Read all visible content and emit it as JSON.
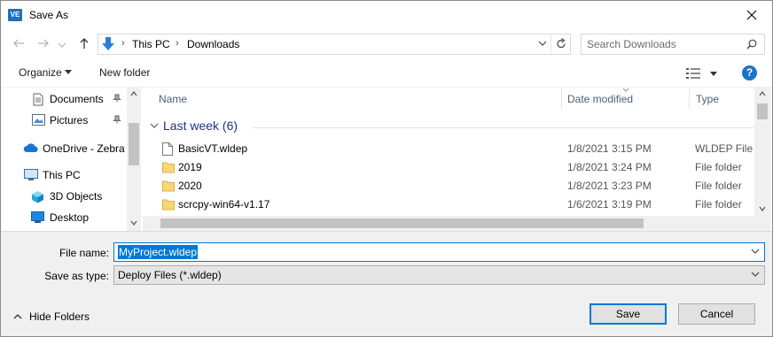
{
  "window": {
    "title": "Save As",
    "app_icon_text": "VE"
  },
  "address": {
    "crumbs": [
      "This PC",
      "Downloads"
    ],
    "search_placeholder": "Search Downloads"
  },
  "toolbar": {
    "organize_label": "Organize",
    "new_folder_label": "New folder",
    "help_label": "?"
  },
  "nav_pane": {
    "items": [
      {
        "label": "Documents",
        "icon": "documents-icon",
        "pinned": true
      },
      {
        "label": "Pictures",
        "icon": "pictures-icon",
        "pinned": true
      },
      {
        "label": "OneDrive - Zebra T",
        "icon": "onedrive-cloud-icon",
        "pinned": false
      },
      {
        "label": "This PC",
        "icon": "this-pc-icon",
        "pinned": false
      },
      {
        "label": "3D Objects",
        "icon": "3d-objects-icon",
        "pinned": false
      },
      {
        "label": "Desktop",
        "icon": "desktop-icon",
        "pinned": false
      }
    ]
  },
  "file_list": {
    "columns": {
      "name": "Name",
      "date": "Date modified",
      "type": "Type"
    },
    "group_label": "Last week (6)",
    "rows": [
      {
        "name": "BasicVT.wldep",
        "date": "1/8/2021 3:15 PM",
        "type": "WLDEP File",
        "icon": "file-icon"
      },
      {
        "name": "2019",
        "date": "1/8/2021 3:24 PM",
        "type": "File folder",
        "icon": "folder-icon"
      },
      {
        "name": "2020",
        "date": "1/8/2021 3:23 PM",
        "type": "File folder",
        "icon": "folder-icon"
      },
      {
        "name": "scrcpy-win64-v1.17",
        "date": "1/6/2021 3:19 PM",
        "type": "File folder",
        "icon": "folder-icon"
      }
    ]
  },
  "form": {
    "file_name_label": "File name:",
    "file_name_value": "MyProject.wldep",
    "save_type_label": "Save as type:",
    "save_type_value": "Deploy Files (*.wldep)"
  },
  "footer": {
    "hide_folders_label": "Hide Folders",
    "save_label": "Save",
    "cancel_label": "Cancel"
  },
  "colors": {
    "accent": "#0078d7",
    "group_header": "#1e3287",
    "folder": "#f8d775"
  }
}
